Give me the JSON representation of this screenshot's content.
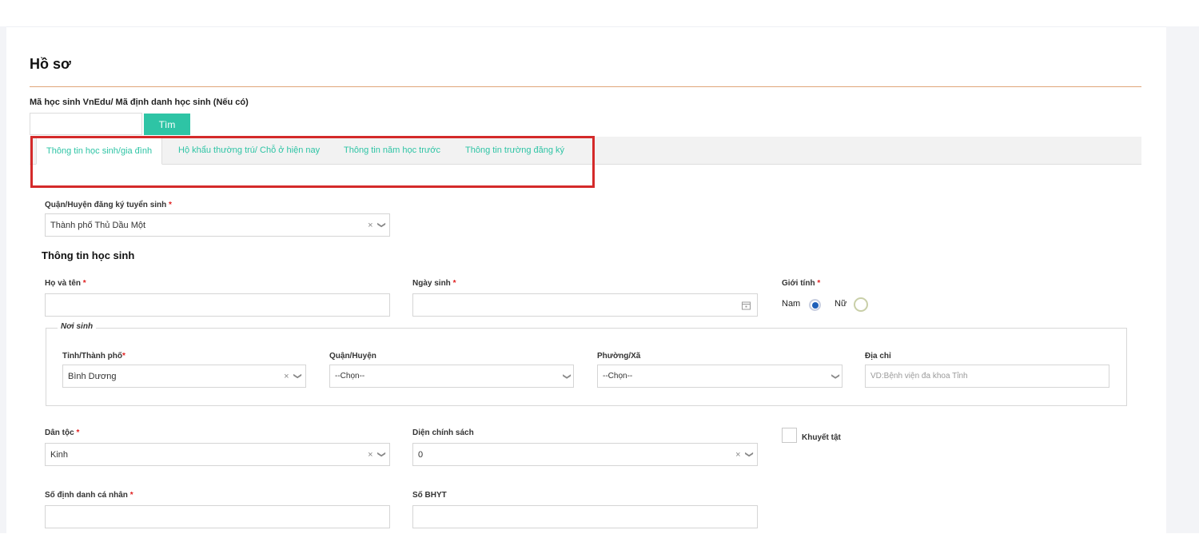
{
  "page": {
    "title": "Hồ sơ"
  },
  "student_id": {
    "label": "Mã học sinh VnEdu/ Mã định danh học sinh (Nếu có)",
    "value": "",
    "search_label": "Tìm"
  },
  "tabs": [
    {
      "label": "Thông tin học sinh/gia đình",
      "active": true
    },
    {
      "label": "Hộ khẩu thường trú/ Chỗ ở hiện nay",
      "active": false
    },
    {
      "label": "Thông tin năm học trước",
      "active": false
    },
    {
      "label": "Thông tin trường đăng ký",
      "active": false
    }
  ],
  "district": {
    "label": "Quận/Huyện đăng ký tuyển sinh",
    "required": "*",
    "value": "Thành phố Thủ Dầu Một"
  },
  "student_section": {
    "title": "Thông tin học sinh"
  },
  "full_name": {
    "label": "Họ và tên",
    "required": "*",
    "value": ""
  },
  "birth_date": {
    "label": "Ngày sinh",
    "required": "*",
    "value": ""
  },
  "gender": {
    "label": "Giới tính",
    "required": "*",
    "male": "Nam",
    "female": "Nữ",
    "selected": "Nam"
  },
  "birthplace": {
    "legend": "Nơi sinh",
    "province": {
      "label": "Tỉnh/Thành phố",
      "required": "*",
      "value": "Bình Dương"
    },
    "district": {
      "label": "Quận/Huyện",
      "value": "--Chọn--"
    },
    "ward": {
      "label": "Phường/Xã",
      "value": "--Chọn--"
    },
    "address": {
      "label": "Địa chỉ",
      "placeholder": "VD:Bệnh viện đa khoa Tỉnh"
    }
  },
  "ethnicity": {
    "label": "Dân tộc",
    "required": "*",
    "value": "Kinh"
  },
  "policy": {
    "label": "Diện chính sách",
    "value": "0"
  },
  "disability": {
    "label": "Khuyết tật",
    "checked": false
  },
  "personal_id": {
    "label": "Số định danh cá nhân",
    "required": "*",
    "value": ""
  },
  "insurance": {
    "label": "Số BHYT",
    "value": ""
  },
  "icons": {
    "clear": "×",
    "chevron": "❯",
    "calendar": "calendar-icon"
  },
  "colors": {
    "accent": "#2ec4a5",
    "highlight": "#d42a2a",
    "required": "#e02020",
    "divider": "#e0a57a"
  }
}
